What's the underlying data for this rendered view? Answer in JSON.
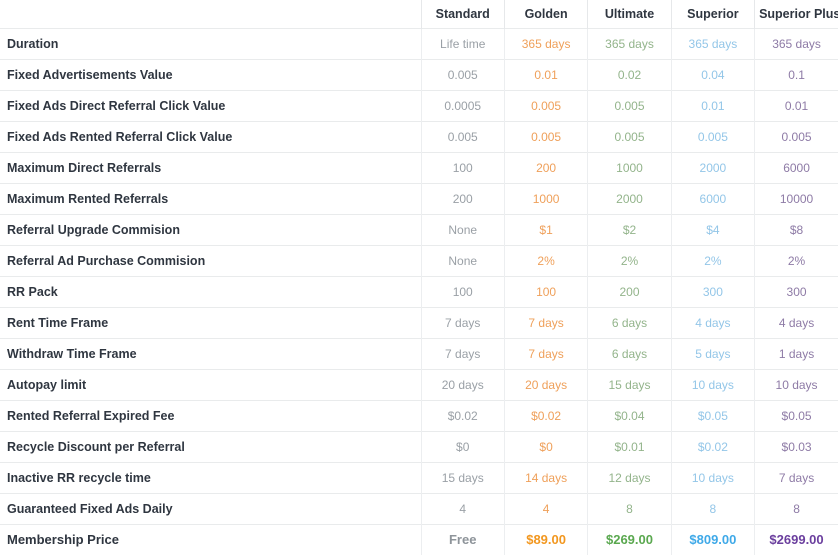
{
  "table": {
    "label_column_header": "",
    "plans": [
      {
        "key": "standard",
        "name": "Standard",
        "color": "#9aa0a6",
        "price_color": "#8e949a"
      },
      {
        "key": "golden",
        "name": "Golden",
        "color": "#efa05a",
        "price_color": "#f2971f"
      },
      {
        "key": "ultimate",
        "name": "Ultimate",
        "color": "#93b48b",
        "price_color": "#5aa84f"
      },
      {
        "key": "superior",
        "name": "Superior",
        "color": "#93c6e8",
        "price_color": "#3fa9e8"
      },
      {
        "key": "superior_plus",
        "name": "Superior Plus",
        "color": "#8e7ba6",
        "price_color": "#6b3f9e"
      }
    ],
    "rows": [
      {
        "feature": "Duration",
        "values": [
          "Life time",
          "365 days",
          "365 days",
          "365 days",
          "365 days"
        ]
      },
      {
        "feature": "Fixed Advertisements Value",
        "values": [
          "0.005",
          "0.01",
          "0.02",
          "0.04",
          "0.1"
        ]
      },
      {
        "feature": "Fixed Ads Direct Referral Click Value",
        "values": [
          "0.0005",
          "0.005",
          "0.005",
          "0.01",
          "0.01"
        ]
      },
      {
        "feature": "Fixed Ads Rented Referral Click Value",
        "values": [
          "0.005",
          "0.005",
          "0.005",
          "0.005",
          "0.005"
        ]
      },
      {
        "feature": "Maximum Direct Referrals",
        "values": [
          "100",
          "200",
          "1000",
          "2000",
          "6000"
        ]
      },
      {
        "feature": "Maximum Rented Referrals",
        "values": [
          "200",
          "1000",
          "2000",
          "6000",
          "10000"
        ]
      },
      {
        "feature": "Referral Upgrade Commision",
        "values": [
          "None",
          "$1",
          "$2",
          "$4",
          "$8"
        ]
      },
      {
        "feature": "Referral Ad Purchase Commision",
        "values": [
          "None",
          "2%",
          "2%",
          "2%",
          "2%"
        ]
      },
      {
        "feature": "RR Pack",
        "values": [
          "100",
          "100",
          "200",
          "300",
          "300"
        ]
      },
      {
        "feature": "Rent Time Frame",
        "values": [
          "7 days",
          "7 days",
          "6 days",
          "4 days",
          "4 days"
        ]
      },
      {
        "feature": "Withdraw Time Frame",
        "values": [
          "7 days",
          "7 days",
          "6 days",
          "5 days",
          "1 days"
        ]
      },
      {
        "feature": "Autopay limit",
        "values": [
          "20 days",
          "20 days",
          "15 days",
          "10 days",
          "10 days"
        ]
      },
      {
        "feature": "Rented Referral Expired Fee",
        "values": [
          "$0.02",
          "$0.02",
          "$0.04",
          "$0.05",
          "$0.05"
        ]
      },
      {
        "feature": "Recycle Discount per Referral",
        "values": [
          "$0",
          "$0",
          "$0.01",
          "$0.02",
          "$0.03"
        ]
      },
      {
        "feature": "Inactive RR recycle time",
        "values": [
          "15 days",
          "14 days",
          "12 days",
          "10 days",
          "7 days"
        ]
      },
      {
        "feature": "Guaranteed Fixed Ads Daily",
        "values": [
          "4",
          "4",
          "8",
          "8",
          "8"
        ]
      },
      {
        "feature": "Membership Price",
        "values": [
          "Free",
          "$89.00",
          "$269.00",
          "$809.00",
          "$2699.00"
        ],
        "is_price": true
      }
    ]
  }
}
